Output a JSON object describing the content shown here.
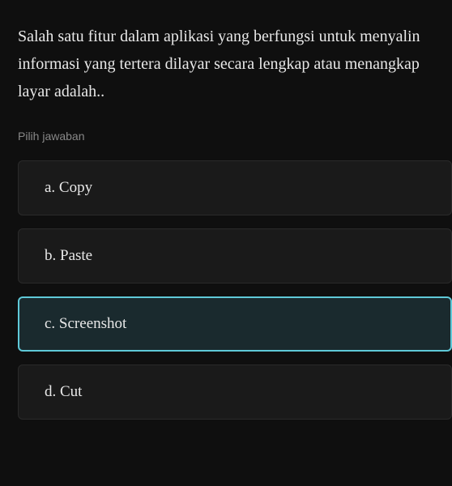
{
  "question": {
    "text": "Salah satu fitur dalam aplikasi yang berfungsi untuk menyalin informasi yang tertera dilayar secara lengkap atau menangkap layar adalah.."
  },
  "prompt": "Pilih jawaban",
  "options": [
    {
      "label": "a. Copy",
      "selected": false
    },
    {
      "label": "b. Paste",
      "selected": false
    },
    {
      "label": "c. Screenshot",
      "selected": true
    },
    {
      "label": "d. Cut",
      "selected": false
    }
  ]
}
